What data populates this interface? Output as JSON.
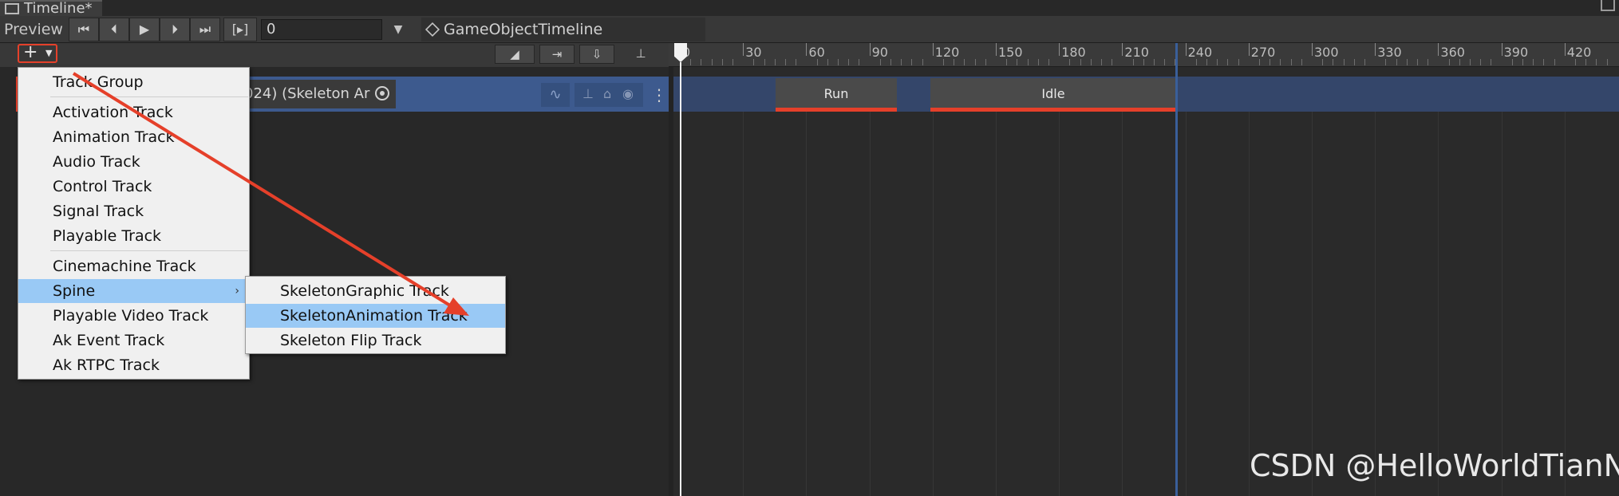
{
  "window": {
    "tab_title": "Timeline*"
  },
  "toolbar": {
    "preview_label": "Preview",
    "buttons": [
      "⏮",
      "⏴",
      "▶",
      "⏵",
      "⏭",
      "[▸]"
    ],
    "frame_value": "0",
    "breadcrumb": "GameObjectTimeline (GameObject)"
  },
  "ruler": {
    "labels": [
      "0",
      "30",
      "60",
      "90",
      "120",
      "150",
      "180",
      "210",
      "240",
      "270",
      "300",
      "330",
      "360",
      "390",
      "420"
    ]
  },
  "track": {
    "name": "024) (Skeleton Ar"
  },
  "clips": [
    {
      "label": "Run"
    },
    {
      "label": "Idle"
    }
  ],
  "add_menu": {
    "items": [
      {
        "label": "Track Group"
      },
      {
        "label": "Activation Track"
      },
      {
        "label": "Animation Track"
      },
      {
        "label": "Audio Track"
      },
      {
        "label": "Control Track"
      },
      {
        "label": "Signal Track"
      },
      {
        "label": "Playable Track"
      },
      {
        "label": "Cinemachine Track"
      },
      {
        "label": "Spine",
        "selected": true,
        "has_submenu": true
      },
      {
        "label": "Playable Video Track"
      },
      {
        "label": "Ak Event Track"
      },
      {
        "label": "Ak RTPC Track"
      }
    ]
  },
  "spine_submenu": {
    "items": [
      {
        "label": "SkeletonGraphic Track"
      },
      {
        "label": "SkeletonAnimation Track",
        "selected": true
      },
      {
        "label": "Skeleton Flip Track"
      }
    ]
  },
  "watermark": "CSDN @HelloWorldTianNa",
  "colors": {
    "accent_red": "#e5402a",
    "selection_blue": "#99c9f5",
    "track_blue": "#3d5a8e"
  }
}
